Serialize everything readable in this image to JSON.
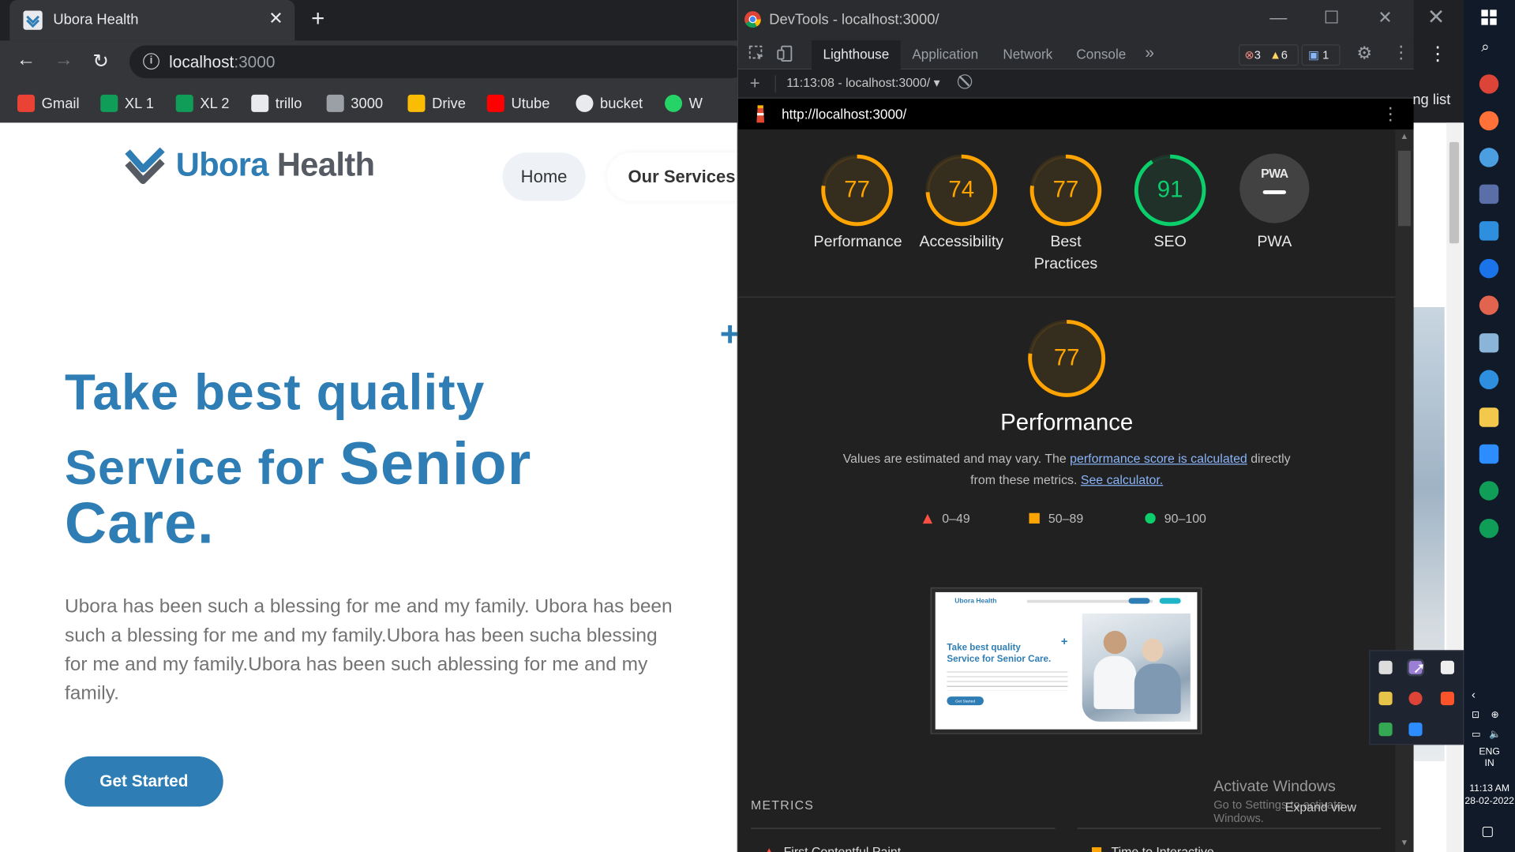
{
  "browser": {
    "tab_title": "Ubora Health",
    "url_host": "localhost",
    "url_port": ":3000",
    "new_tab_symbol": "+",
    "bookmarks": [
      {
        "label": "Gmail",
        "icon": "gmail-icon",
        "color": "#ea4335"
      },
      {
        "label": "XL 1",
        "icon": "sheets-icon",
        "color": "#0f9d58"
      },
      {
        "label": "XL 2",
        "icon": "sheets-icon",
        "color": "#0f9d58"
      },
      {
        "label": "trillo",
        "icon": "trillo-icon",
        "color": "#e8eaed"
      },
      {
        "label": "3000",
        "icon": "ubora-icon",
        "color": "#9aa0a6"
      },
      {
        "label": "Drive",
        "icon": "drive-icon",
        "color": "#fbbc04"
      },
      {
        "label": "Utube",
        "icon": "youtube-icon",
        "color": "#ff0000"
      },
      {
        "label": "bucket",
        "icon": "globe-icon",
        "color": "#e8eaed"
      },
      {
        "label": "W",
        "icon": "whatsapp-icon",
        "color": "#25d366"
      }
    ],
    "reading_list_label": "ng list"
  },
  "site": {
    "logo_a": "Ubora",
    "logo_b": " Health",
    "nav_home": "Home",
    "nav_services": "Our Services",
    "hero_line1": "Take best quality",
    "hero_line2a": "Service for ",
    "hero_line2b": "Senior",
    "hero_line3": "Care.",
    "hero_body": "Ubora has been such a blessing for me and my family. Ubora has been such a blessing for me and my family.Ubora has been sucha blessing for me and my family.Ubora has been such ablessing for me and my family.",
    "cta": "Get Started",
    "brand_color": "#2e7eb5"
  },
  "devtools": {
    "window_title": "DevTools - localhost:3000/",
    "tabs": [
      "Lighthouse",
      "Application",
      "Network",
      "Console"
    ],
    "more_tabs": "»",
    "errors": "3",
    "warnings": "6",
    "messages": "1",
    "report_selector": "11:13:08 - localhost:3000/",
    "report_url": "http://localhost:3000/",
    "gauges": [
      {
        "label": "Performance",
        "score": 77,
        "color": "#ffa400"
      },
      {
        "label": "Accessibility",
        "score": 74,
        "color": "#ffa400"
      },
      {
        "label": "Best\nPractices",
        "score": 77,
        "color": "#ffa400"
      },
      {
        "label": "SEO",
        "score": 91,
        "color": "#0cce6b"
      }
    ],
    "pwa_label": "PWA",
    "pwa_badge": "PWA",
    "perf_score": 77,
    "perf_title": "Performance",
    "perf_desc_1": "Values are estimated and may vary. The ",
    "perf_desc_link1": "performance score is calculated",
    "perf_desc_2": " directly from these metrics. ",
    "perf_desc_link2": "See calculator.",
    "legend": [
      {
        "range": "0–49",
        "shape": "triangle",
        "color": "#ff4e42"
      },
      {
        "range": "50–89",
        "shape": "square",
        "color": "#ffa400"
      },
      {
        "range": "90–100",
        "shape": "circle",
        "color": "#0cce6b"
      }
    ],
    "metrics_label": "METRICS",
    "metric_1": "First Contentful Paint",
    "metric_2": "Time to Interactive",
    "activate_windows": "Activate Windows",
    "activate_sub": "Go to Settings to activate Windows.",
    "expand_view": "Expand view"
  },
  "thumbnail": {
    "logo": "Ubora Health",
    "hero": "Take best quality",
    "hero2": "Service for Senior Care.",
    "cta": "Get Started"
  },
  "taskbar": {
    "lang_1": "ENG",
    "lang_2": "IN",
    "time": "11:13 AM",
    "date": "28-02-2022"
  }
}
